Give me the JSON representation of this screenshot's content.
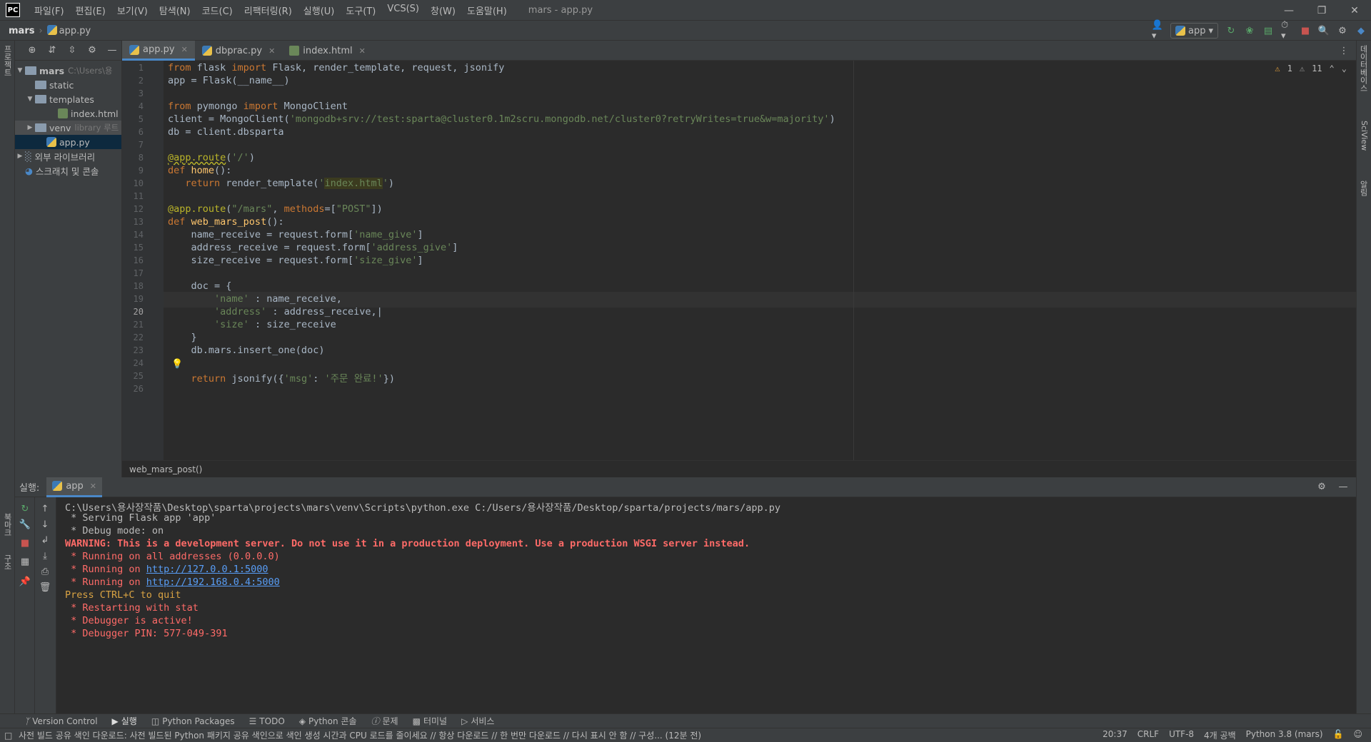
{
  "app": {
    "window_title": "mars - app.py",
    "menu": [
      "파일(F)",
      "편집(E)",
      "보기(V)",
      "탐색(N)",
      "코드(C)",
      "리팩터링(R)",
      "실행(U)",
      "도구(T)",
      "VCS(S)",
      "창(W)",
      "도움말(H)"
    ],
    "logo": "PC"
  },
  "navbar": {
    "project": "mars",
    "file": "app.py",
    "run_config": "app"
  },
  "leftstrip": {
    "project_tab": "프로젝트",
    "bookmarks_tab": "북마크",
    "structure_tab": "구조"
  },
  "rightstrip": {
    "db_tab": "데이터베이스",
    "sciview_tab": "SciView",
    "notifications_tab": "알림"
  },
  "project_tree": [
    {
      "label": "mars",
      "hint": "C:\\Users\\용",
      "type": "folder",
      "level": 0,
      "expanded": true
    },
    {
      "label": "static",
      "type": "folder",
      "level": 1
    },
    {
      "label": "templates",
      "type": "folder",
      "level": 1,
      "expanded": true
    },
    {
      "label": "index.html",
      "type": "html",
      "level": 2
    },
    {
      "label": "venv",
      "hint": "library 루트",
      "type": "folder",
      "level": 1,
      "collapsed": true
    },
    {
      "label": "app.py",
      "type": "py",
      "level": 1,
      "selected": true
    },
    {
      "label": "외부 라이브러리",
      "type": "lib",
      "level": 0,
      "collapsed": true
    },
    {
      "label": "스크래치 및 콘솔",
      "type": "scratch",
      "level": 0
    }
  ],
  "tabs": [
    {
      "label": "app.py",
      "type": "py",
      "active": true
    },
    {
      "label": "dbprac.py",
      "type": "py"
    },
    {
      "label": "index.html",
      "type": "html"
    }
  ],
  "inspections": {
    "warnings": "1",
    "weak_warnings": "11"
  },
  "code_lines": [
    "1",
    "2",
    "3",
    "4",
    "5",
    "6",
    "7",
    "8",
    "9",
    "10",
    "11",
    "12",
    "13",
    "14",
    "15",
    "16",
    "17",
    "18",
    "19",
    "20",
    "21",
    "22",
    "23",
    "24",
    "25",
    "26"
  ],
  "current_line": "20",
  "breadcrumb": "web_mars_post()",
  "run_panel": {
    "label": "실행:",
    "tab": "app",
    "console": [
      {
        "text": "C:\\Users\\용사장작품\\Desktop\\sparta\\projects\\mars\\venv\\Scripts\\python.exe C:/Users/용사장작품/Desktop/sparta/projects/mars/app.py",
        "style": ""
      },
      {
        "text": " * Serving Flask app 'app'",
        "style": ""
      },
      {
        "text": " * Debug mode: on",
        "style": ""
      },
      {
        "text": "WARNING: This is a development server. Do not use it in a production deployment. Use a production WSGI server instead.",
        "style": "errb"
      },
      {
        "text": " * Running on all addresses (0.0.0.0)",
        "style": "err"
      },
      {
        "text": " * Running on ",
        "link": "http://127.0.0.1:5000",
        "style": "err"
      },
      {
        "text": " * Running on ",
        "link": "http://192.168.0.4:5000",
        "style": "err"
      },
      {
        "text": "Press CTRL+C to quit",
        "style": "warn"
      },
      {
        "text": " * Restarting with stat",
        "style": "err"
      },
      {
        "text": " * Debugger is active!",
        "style": "err"
      },
      {
        "text": " * Debugger PIN: 577-049-391",
        "style": "err"
      }
    ]
  },
  "bottom_tabs": [
    "Version Control",
    "실행",
    "Python Packages",
    "TODO",
    "Python 콘솔",
    "문제",
    "터미널",
    "서비스"
  ],
  "status": {
    "message": "사전 빌드 공유 색인 다운로드: 사전 빌드된 Python 패키지 공유 색인으로 색인 생성 시간과 CPU 로드를 줄이세요 // 항상 다운로드 // 한 번만 다운로드 // 다시 표시 안 함 // 구성... (12분 전)",
    "position": "20:37",
    "line_sep": "CRLF",
    "encoding": "UTF-8",
    "indent": "4개 공백",
    "interpreter": "Python 3.8 (mars)"
  },
  "colors": {
    "accent": "#4a88c7",
    "keyword": "#cc7832",
    "string": "#6a8759",
    "decorator": "#bbb529",
    "error": "#ff6b68"
  }
}
